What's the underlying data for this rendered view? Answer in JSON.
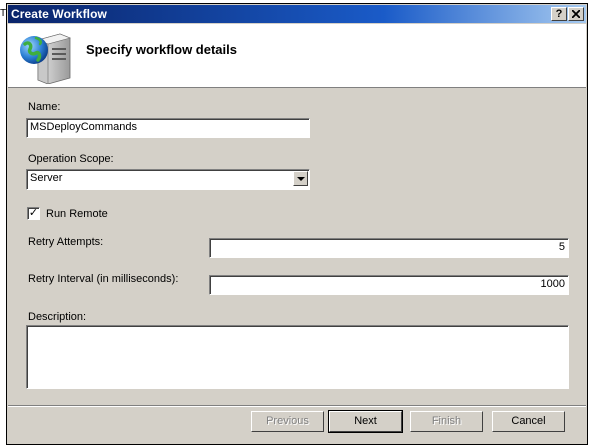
{
  "window": {
    "title": "Create Workflow",
    "help_button": "?",
    "close_button": "✕"
  },
  "header": {
    "title": "Specify workflow details",
    "icon": "server-globe-icon"
  },
  "form": {
    "name_label": "Name:",
    "name_value": "MSDeployCommands",
    "scope_label": "Operation Scope:",
    "scope_value": "Server",
    "run_remote_label": "Run Remote",
    "run_remote_checked": true,
    "retry_attempts_label": "Retry Attempts:",
    "retry_attempts_value": "5",
    "retry_interval_label": "Retry Interval (in milliseconds):",
    "retry_interval_value": "1000",
    "description_label": "Description:",
    "description_value": ""
  },
  "buttons": {
    "previous": "Previous",
    "next": "Next",
    "finish": "Finish",
    "cancel": "Cancel"
  },
  "colors": {
    "titlebar_start": "#0a246a",
    "titlebar_end": "#a6caf0",
    "dialog_bg": "#d4d0c8"
  }
}
